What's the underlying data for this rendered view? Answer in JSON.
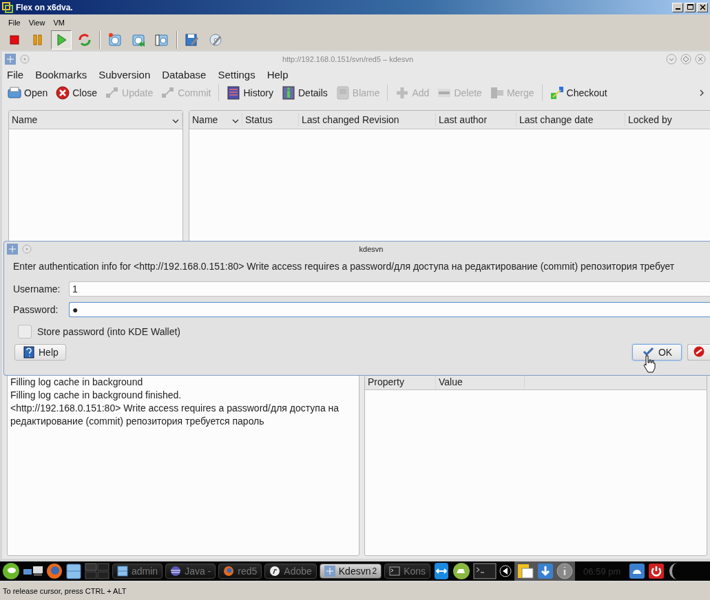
{
  "vm_window": {
    "title": "Flex on x6dva.",
    "menu": [
      "File",
      "View",
      "VM"
    ],
    "toolbar": [
      {
        "selected": false
      },
      {
        "selected": false
      },
      {
        "selected": true
      },
      {
        "selected": false
      },
      {
        "selected": false
      },
      {
        "selected": false
      },
      {
        "selected": false
      },
      {
        "selected": false
      },
      {
        "selected": false
      }
    ]
  },
  "kdesvn_window": {
    "title": "http://192.168.0.151/svn/red5 – kdesvn",
    "menu": [
      "File",
      "Bookmarks",
      "Subversion",
      "Database",
      "Settings",
      "Help"
    ],
    "toolbar": [
      {
        "label": "Open",
        "disabled": false,
        "separator_before": false
      },
      {
        "label": "Close",
        "disabled": false,
        "separator_before": false
      },
      {
        "label": "Update",
        "disabled": true,
        "separator_before": false
      },
      {
        "label": "Commit",
        "disabled": true,
        "separator_before": false
      },
      {
        "label": "History",
        "disabled": false,
        "separator_before": true
      },
      {
        "label": "Details",
        "disabled": false,
        "separator_before": false
      },
      {
        "label": "Blame",
        "disabled": true,
        "separator_before": false
      },
      {
        "label": "Add",
        "disabled": true,
        "separator_before": true
      },
      {
        "label": "Delete",
        "disabled": true,
        "separator_before": false
      },
      {
        "label": "Merge",
        "disabled": true,
        "separator_before": false
      },
      {
        "label": "Checkout",
        "disabled": false,
        "separator_before": true
      }
    ],
    "tree_pane": {
      "columns": [
        "Name"
      ]
    },
    "file_list": {
      "columns": [
        "Name",
        "Status",
        "Last changed Revision",
        "Last author",
        "Last change date",
        "Locked by"
      ]
    },
    "log": {
      "lines": [
        "Filling log cache in background",
        "Filling log cache in background finished.",
        "<http://192.168.0.151:80> Write access requires a password/для доступа на редактирование (commit) репозитория требуется пароль"
      ]
    },
    "properties": {
      "columns": [
        "Property",
        "Value"
      ]
    }
  },
  "dialog": {
    "title": "kdesvn",
    "message": "Enter authentication info for <http://192.168.0.151:80> Write access requires a password/для доступа на редактирование (commit) репозитория требует",
    "fields": [
      {
        "label": "Username:",
        "value": "1",
        "focused": false
      },
      {
        "label": "Password:",
        "value": "●",
        "focused": true
      }
    ],
    "checkbox": {
      "label": "Store password (into KDE Wallet)",
      "checked": false
    },
    "buttons": [
      {
        "kind": "help",
        "label": "Help",
        "focused": false
      },
      {
        "kind": "ok",
        "label": "OK",
        "focused": true
      },
      {
        "kind": "cancel",
        "focused": false
      }
    ]
  },
  "taskbar": {
    "tasks": [
      {
        "label": "admin",
        "selected": false
      },
      {
        "label": "Java -",
        "selected": false
      },
      {
        "label": "red5",
        "selected": false
      },
      {
        "label": "Adobe",
        "selected": false
      },
      {
        "label": "Kdesvn",
        "count": "2",
        "selected": true
      },
      {
        "label": "Kons",
        "selected": false
      }
    ],
    "clock": "06:59 pm"
  },
  "status_bar": "To release cursor, press CTRL + ALT"
}
